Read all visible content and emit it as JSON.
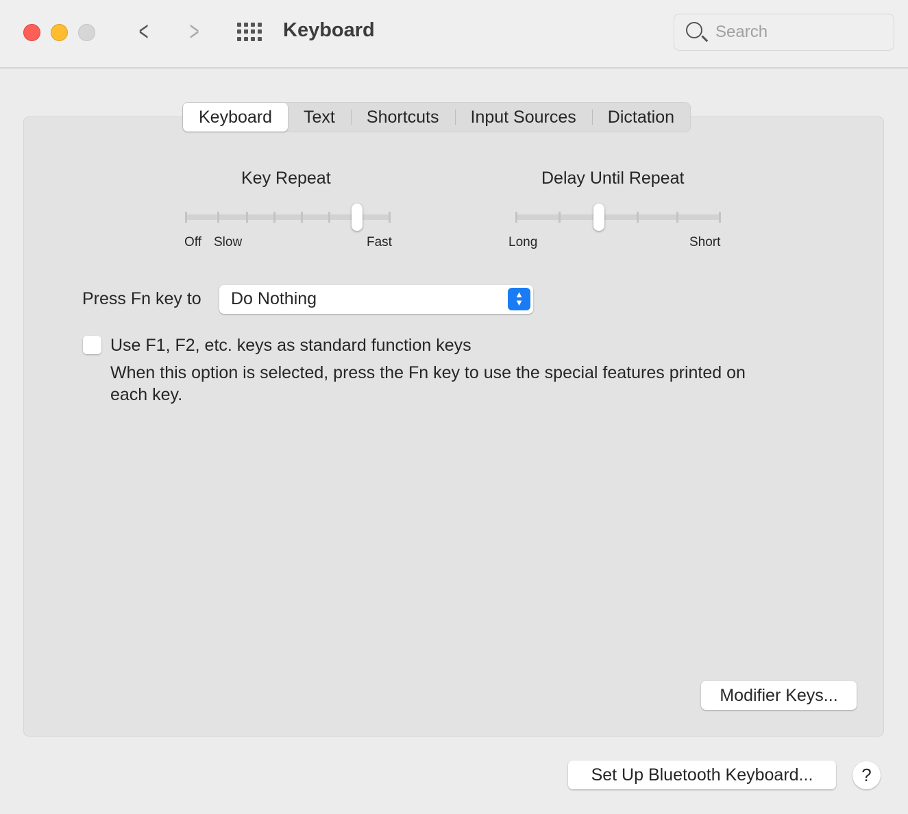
{
  "window": {
    "title": "Keyboard",
    "search_placeholder": "Search",
    "colors": {
      "close": "#fe5f57",
      "minimize": "#febc2e",
      "zoom": "#d6d6d6",
      "accent": "#1a7cf5"
    }
  },
  "tabs": [
    {
      "label": "Keyboard",
      "selected": true
    },
    {
      "label": "Text"
    },
    {
      "label": "Shortcuts"
    },
    {
      "label": "Input Sources"
    },
    {
      "label": "Dictation"
    }
  ],
  "key_repeat": {
    "title": "Key Repeat",
    "labels": {
      "off": "Off",
      "slow": "Slow",
      "fast": "Fast"
    },
    "ticks": 8,
    "value_index": 6
  },
  "delay_until_repeat": {
    "title": "Delay Until Repeat",
    "labels": {
      "long": "Long",
      "short": "Short"
    },
    "ticks": 6,
    "value_index": 2
  },
  "fn_key": {
    "label": "Press Fn key to",
    "value": "Do Nothing"
  },
  "function_keys": {
    "label": "Use F1, F2, etc. keys as standard function keys",
    "checked": false,
    "description_line1": "When this option is selected, press the Fn key to use the special features printed on",
    "description_line2": "each key."
  },
  "buttons": {
    "modifier_keys": "Modifier Keys...",
    "bluetooth": "Set Up Bluetooth Keyboard...",
    "help": "?"
  }
}
